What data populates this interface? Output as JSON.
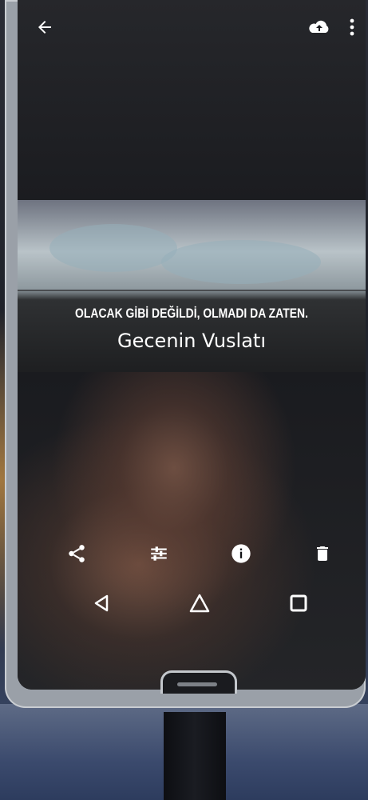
{
  "toolbar": {
    "back_icon": "arrow-left-icon",
    "upload_icon": "cloud-upload-icon",
    "more_icon": "more-vertical-icon"
  },
  "image": {
    "quote": "OLACAK GİBİ DEĞİLDİ, OLMADI DA ZATEN.",
    "author": "Gecenin Vuslatı"
  },
  "actions": [
    "share-icon",
    "edit-icon",
    "info-icon",
    "delete-icon"
  ],
  "system_nav": [
    "back-triangle-icon",
    "home-icon",
    "recents-icon"
  ],
  "colors": {
    "icon": "#ffffff",
    "screen": "#101114"
  }
}
